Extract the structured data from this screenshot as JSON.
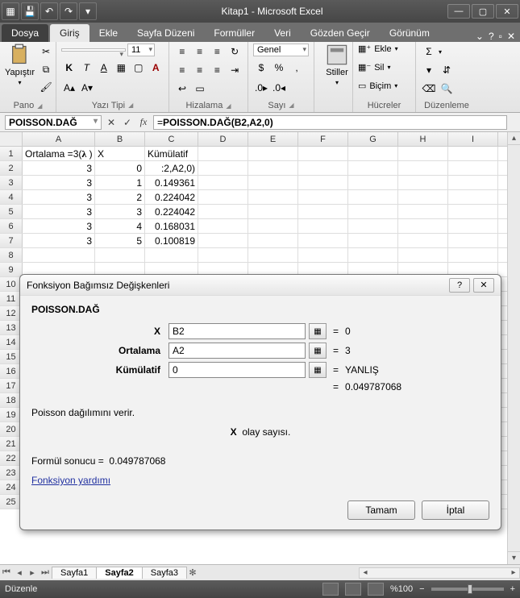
{
  "title": "Kitap1 - Microsoft Excel",
  "ribbon": {
    "file": "Dosya",
    "tabs": [
      "Giriş",
      "Ekle",
      "Sayfa Düzeni",
      "Formüller",
      "Veri",
      "Gözden Geçir",
      "Görünüm"
    ],
    "active": 0,
    "groups": {
      "pano": {
        "paste": "Yapıştır",
        "label": "Pano"
      },
      "font": {
        "name": "",
        "size": "11",
        "label": "Yazı Tipi"
      },
      "align": {
        "label": "Hizalama"
      },
      "number": {
        "format": "Genel",
        "label": "Sayı"
      },
      "styles": {
        "btn": "Stiller"
      },
      "cells": {
        "insert": "Ekle",
        "delete": "Sil",
        "format": "Biçim",
        "label": "Hücreler"
      },
      "editing": {
        "label": "Düzenleme"
      }
    }
  },
  "formula_bar": {
    "name_box": "POISSON.DAĞ",
    "formula_display": "=POISSON.DAĞ(B2,A2,0)",
    "formula_plain": "=",
    "formula_bold": "POISSON.DAĞ(B2,A2,0)"
  },
  "grid": {
    "cols": [
      "A",
      "B",
      "C",
      "D",
      "E",
      "F",
      "G",
      "H",
      "I"
    ],
    "rows": [
      {
        "n": 1,
        "a": "Ortalama =3(",
        "a_sym": "λ",
        "a_tail": " )",
        "b": "X",
        "c": "Kümülatif"
      },
      {
        "n": 2,
        "a": "3",
        "b": "0",
        "c": ":2,A2,0)"
      },
      {
        "n": 3,
        "a": "3",
        "b": "1",
        "c": "0.149361"
      },
      {
        "n": 4,
        "a": "3",
        "b": "2",
        "c": "0.224042"
      },
      {
        "n": 5,
        "a": "3",
        "b": "3",
        "c": "0.224042"
      },
      {
        "n": 6,
        "a": "3",
        "b": "4",
        "c": "0.168031"
      },
      {
        "n": 7,
        "a": "3",
        "b": "5",
        "c": "0.100819"
      }
    ],
    "extra_rows": [
      8,
      9,
      10,
      11,
      12,
      13,
      14,
      15,
      16,
      17,
      18,
      19,
      20,
      21,
      22,
      23,
      24,
      25
    ]
  },
  "sheets": {
    "tabs": [
      "Sayfa1",
      "Sayfa2",
      "Sayfa3"
    ],
    "active": 1
  },
  "status": {
    "mode": "Düzenle",
    "zoom": "%100"
  },
  "dialog": {
    "title": "Fonksiyon Bağımsız Değişkenleri",
    "fn": "POISSON.DAĞ",
    "args": [
      {
        "label": "X",
        "bold": true,
        "value": "B2",
        "result": "0"
      },
      {
        "label": "Ortalama",
        "bold": true,
        "value": "A2",
        "result": "3"
      },
      {
        "label": "Kümülatif",
        "bold": true,
        "value": "0",
        "result": "YANLIŞ"
      }
    ],
    "preview": "0.049787068",
    "desc": "Poisson dağılımını verir.",
    "arg_desc_label": "X",
    "arg_desc_text": "olay sayısı.",
    "result_label": "Formül sonucu =",
    "result_value": "0.049787068",
    "help": "Fonksiyon yardımı",
    "ok": "Tamam",
    "cancel": "İptal"
  }
}
